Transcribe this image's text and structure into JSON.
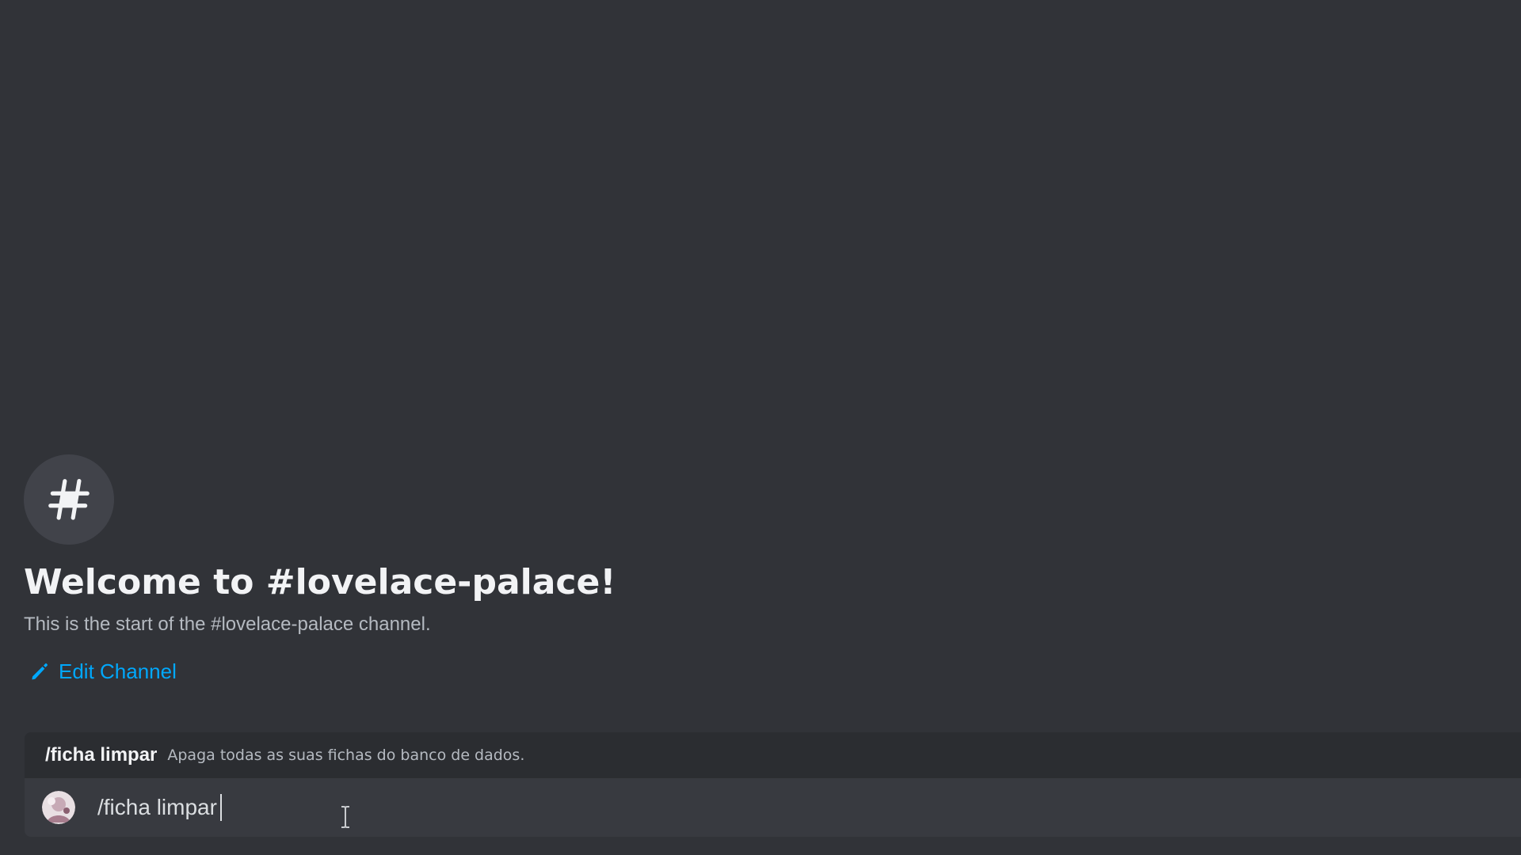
{
  "colors": {
    "background": "#313338",
    "accent_link": "#00a8fc",
    "autocomplete_bg": "#2b2d31",
    "composer_bg": "#383a40"
  },
  "channel_header": {
    "icon": "hashtag-icon",
    "title": "Welcome to #lovelace-palace!",
    "description": "This is the start of the #lovelace-palace channel."
  },
  "edit_channel": {
    "icon": "pencil-icon",
    "label": "Edit Channel"
  },
  "autocomplete": {
    "command": "/ficha limpar",
    "description": "Apaga todas as suas fichas do banco de dados."
  },
  "composer": {
    "avatar": "user-avatar",
    "value": "/ficha limpar"
  },
  "cursor": "text-cursor-icon"
}
